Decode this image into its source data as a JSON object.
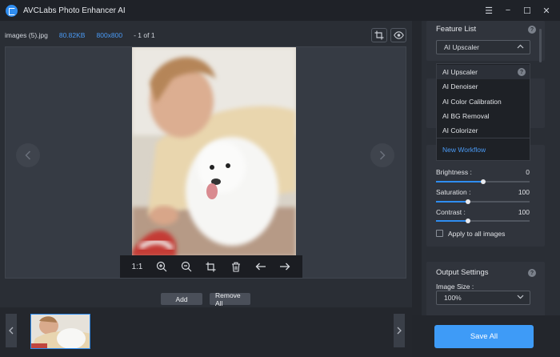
{
  "app": {
    "title": "AVCLabs Photo Enhancer AI"
  },
  "window": {
    "minimize": "−",
    "menu": "☰",
    "maximize": "☐",
    "close": "✕"
  },
  "file_info": {
    "name": "images (5).jpg",
    "size": "80.82KB",
    "dimensions": "800x800",
    "count": "- 1 of 1"
  },
  "viewer_toolbar": {
    "one_to_one": "1:1"
  },
  "actions": {
    "add": "Add",
    "remove_all": "Remove All"
  },
  "feature_list": {
    "title": "Feature List",
    "selected": "AI Upscaler",
    "options": [
      "AI Upscaler",
      "AI Denoiser",
      "AI Color Calibration",
      "AI BG Removal",
      "AI Colorizer"
    ],
    "new_workflow": "New Workflow"
  },
  "adjustments": {
    "sliders": [
      {
        "label": "Brightness :",
        "value": 0,
        "display": "0",
        "fraction": 0.5
      },
      {
        "label": "Saturation :",
        "value": 100,
        "display": "100",
        "fraction": 0.34
      },
      {
        "label": "Contrast :",
        "value": 100,
        "display": "100",
        "fraction": 0.34
      }
    ],
    "apply_all": "Apply to all images"
  },
  "output": {
    "title": "Output Settings",
    "image_size_label": "Image Size :",
    "image_size_value": "100%"
  },
  "save_all": "Save All",
  "colors": {
    "accent": "#3e9bf7",
    "link": "#4a9af5",
    "background": "#24272e"
  }
}
